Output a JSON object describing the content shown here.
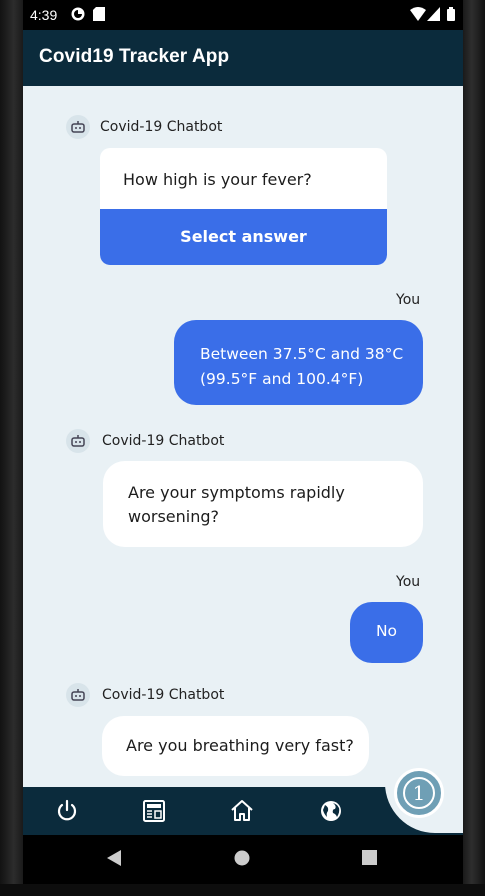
{
  "status_bar": {
    "time": "4:39"
  },
  "app_bar": {
    "title": "Covid19 Tracker App"
  },
  "chat": {
    "messages": [
      {
        "sender": "Covid-19 Chatbot",
        "text": "How high is your fever?",
        "action": "Select answer"
      },
      {
        "sender": "You",
        "text_line1": "Between 37.5°C and 38°C",
        "text_line2": "(99.5°F and 100.4°F)"
      },
      {
        "sender": "Covid-19 Chatbot",
        "text_line1": "Are your symptoms rapidly",
        "text_line2": "worsening?"
      },
      {
        "sender": "You",
        "text": "No"
      },
      {
        "sender": "Covid-19 Chatbot",
        "text": "Are you breathing very fast?"
      }
    ]
  },
  "bottom_nav": {
    "items": [
      {
        "icon": "power-icon"
      },
      {
        "icon": "news-icon"
      },
      {
        "icon": "home-icon"
      },
      {
        "icon": "globe-icon"
      }
    ],
    "fab_badge": "1"
  },
  "colors": {
    "app_bar": "#0b2b3c",
    "chat_bg": "#e9f1f5",
    "accent": "#3a6ee8",
    "fab": "#6f9fb5"
  }
}
